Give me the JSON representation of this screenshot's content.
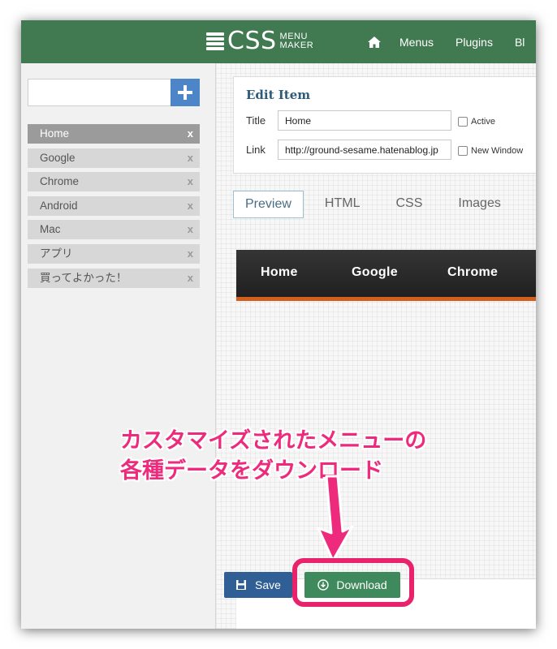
{
  "header": {
    "logo_main": "CSS",
    "logo_sub_1": "MENU",
    "logo_sub_2": "MAKER",
    "nav": [
      "Menus",
      "Plugins",
      "Bl"
    ]
  },
  "sidebar": {
    "add_placeholder": "",
    "items": [
      {
        "label": "Home",
        "remove": "x"
      },
      {
        "label": "Google",
        "remove": "x"
      },
      {
        "label": "Chrome",
        "remove": "x"
      },
      {
        "label": "Android",
        "remove": "x"
      },
      {
        "label": "Mac",
        "remove": "x"
      },
      {
        "label": "アプリ",
        "remove": "x"
      },
      {
        "label": "買ってよかった！",
        "remove": "x"
      }
    ]
  },
  "edit": {
    "heading": "Edit Item",
    "title_label": "Title",
    "title_value": "Home",
    "link_label": "Link",
    "link_value": "http://ground-sesame.hatenablog.jp",
    "active_label": "Active",
    "new_window_label": "New Window"
  },
  "tabs": [
    "Preview",
    "HTML",
    "CSS",
    "Images"
  ],
  "preview": {
    "links": [
      "Home",
      "Google",
      "Chrome"
    ],
    "accent_color": "#d35f1e"
  },
  "annotation": {
    "line1": "カスタマイズされたメニューの",
    "line2": "各種データをダウンロード",
    "color": "#ee2a7d"
  },
  "actions": {
    "save_label": "Save",
    "download_label": "Download"
  },
  "colors": {
    "header": "#417951",
    "add_button": "#4c86c9",
    "save_button": "#2f5f94",
    "download_button": "#3f8a5d",
    "highlight": "#e8236b"
  }
}
